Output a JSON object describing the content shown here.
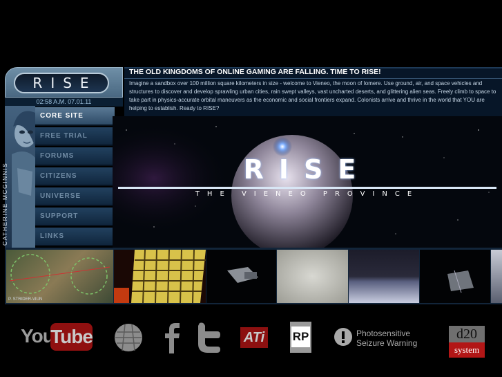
{
  "logo": {
    "text": "RISE"
  },
  "clock": {
    "time": "02:58 A.M. 07.01.11"
  },
  "header": {
    "headline": "THE OLD KINGDOMS OF ONLINE GAMING ARE FALLING.  TIME TO RISE!",
    "blurb": "Imagine a sandbox over 100 million square kilometers in size - welcome to Vieneo, the moon of Iomere.  Use ground, air, and space vehicles and structures to discover and develop sprawling urban cities, rain swept valleys, vast uncharted deserts, and glittering alien seas.  Freely climb to space to take part in physics-accurate orbital maneuvers as the economic and social frontiers expand.  Colonists arrive and thrive in the world that YOU are helping to establish.  Ready to RISE?"
  },
  "sidebar": {
    "portrait_name": "CATHERINE MCGINNIS",
    "items": [
      {
        "label": "CORE SITE",
        "active": true
      },
      {
        "label": "FREE TRIAL",
        "active": false
      },
      {
        "label": "FORUMS",
        "active": false
      },
      {
        "label": "CITIZENS",
        "active": false
      },
      {
        "label": "UNIVERSE",
        "active": false
      },
      {
        "label": "SUPPORT",
        "active": false
      },
      {
        "label": "LINKS",
        "active": false
      }
    ]
  },
  "banner": {
    "title": "RISE",
    "subtitle": "THE VIENEO PROVINCE"
  },
  "thumbnails": {
    "caption": "P. STRIDER-VIUN",
    "items": [
      "terrain-map-thumb",
      "grid-structure-thumb",
      "spacecraft-thumb",
      "foggy-surface-thumb",
      "planet-horizon-thumb",
      "station-thumb"
    ]
  },
  "footer": {
    "youtube": {
      "you": "You",
      "tube": "Tube"
    },
    "warning": {
      "line1": "Photosensitive",
      "line2": "Seizure Warning"
    },
    "ati": "ATi",
    "esrb": "RP",
    "d20": {
      "top": "d20",
      "bottom": "system"
    }
  },
  "colors": {
    "accent": "#5a7995",
    "header_bg": "#071628",
    "youtube_red": "#8f1010"
  }
}
